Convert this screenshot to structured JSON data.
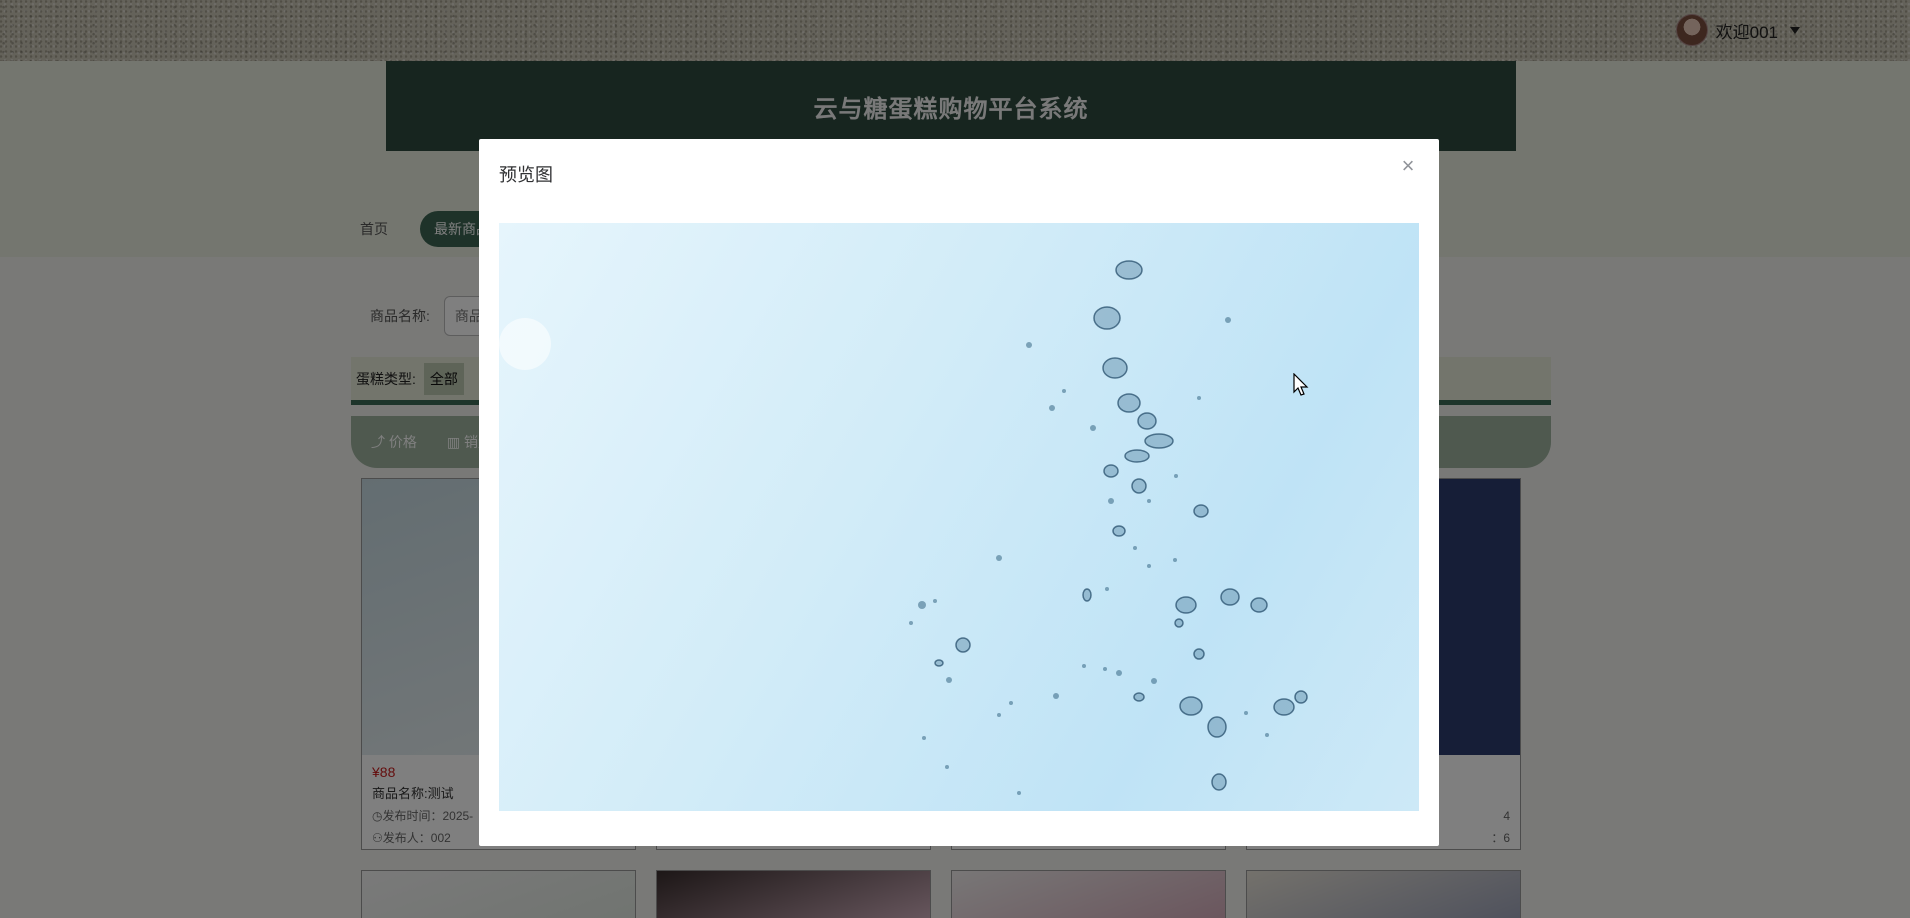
{
  "user_menu": {
    "greeting": "欢迎001"
  },
  "banner": {
    "title": "云与糖蛋糕购物平台系统"
  },
  "nav": {
    "items": [
      {
        "label": "首页"
      },
      {
        "label": "最新商品"
      }
    ]
  },
  "search": {
    "label": "商品名称:",
    "placeholder": "商品名称"
  },
  "filter": {
    "label": "蛋糕类型:",
    "selected": "全部"
  },
  "sort": {
    "items": [
      {
        "label": "价格",
        "icon": "trend-up-icon"
      },
      {
        "label": "销量",
        "icon": "bar-chart-icon"
      }
    ]
  },
  "cards": [
    {
      "price": "¥88",
      "name": "商品名称:测试",
      "time": "发布时间：2025-",
      "publisher": "发布人：002"
    },
    {
      "tail_line1": "4",
      "tail_line2": "：6"
    }
  ],
  "modal": {
    "title": "预览图",
    "close_label": "×"
  },
  "colors": {
    "banner": "#2f4a3f",
    "nav_active": "#3c6552",
    "price": "#c81c1c"
  }
}
